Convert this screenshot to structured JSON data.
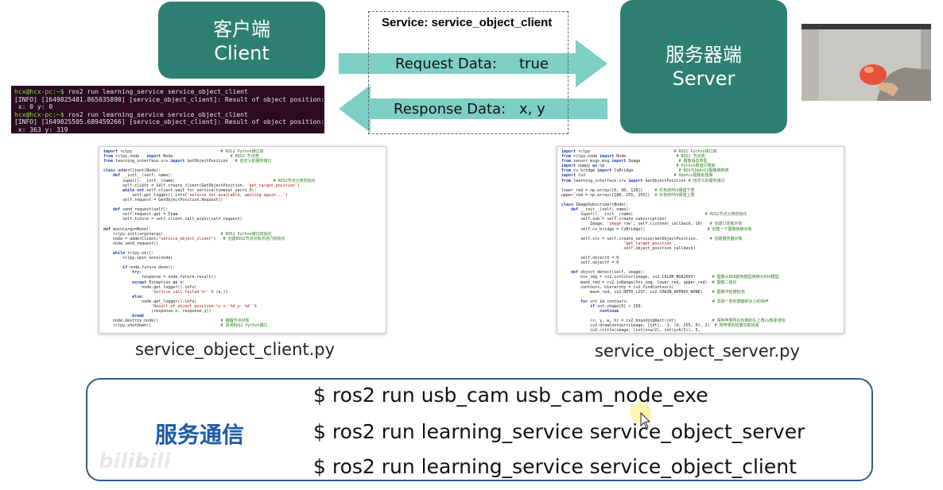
{
  "client_node": {
    "zh": "客户端",
    "en": "Client"
  },
  "server_node": {
    "zh": "服务器端",
    "en": "Server"
  },
  "service": {
    "title": "Service:   service_object_client",
    "request_label": "Request Data:",
    "request_value": "true",
    "response_label": "Response Data:",
    "response_value": "x, y"
  },
  "terminal": {
    "lines": [
      "hcx@hcx-pc:~$ ros2 run learning_service service_object_client",
      "[INFO] [1649825481.865035890] [service_object_client]: Result of object position:",
      " x: 0 y: 0",
      "hcx@hcx-pc:~$ ros2 run learning_service service_object_client",
      "[INFO] [1649825505.689459266] [service_object_client]: Result of object position:",
      " x: 363 y: 319"
    ]
  },
  "client_code_caption": "service_object_client.py",
  "server_code_caption": "service_object_server.py",
  "commands": {
    "title": "服务通信",
    "lines": [
      "$ ros2 run usb_cam usb_cam_node_exe",
      "$ ros2 run learning_service service_object_server",
      "$ ros2 run learning_service service_object_client"
    ]
  },
  "colors": {
    "node": "#2e7f72",
    "arrow": "#7ecfc5",
    "cmd_border": "#2f5d8f",
    "cmd_title": "#1f5aa6"
  },
  "watermark": "bilibili"
}
